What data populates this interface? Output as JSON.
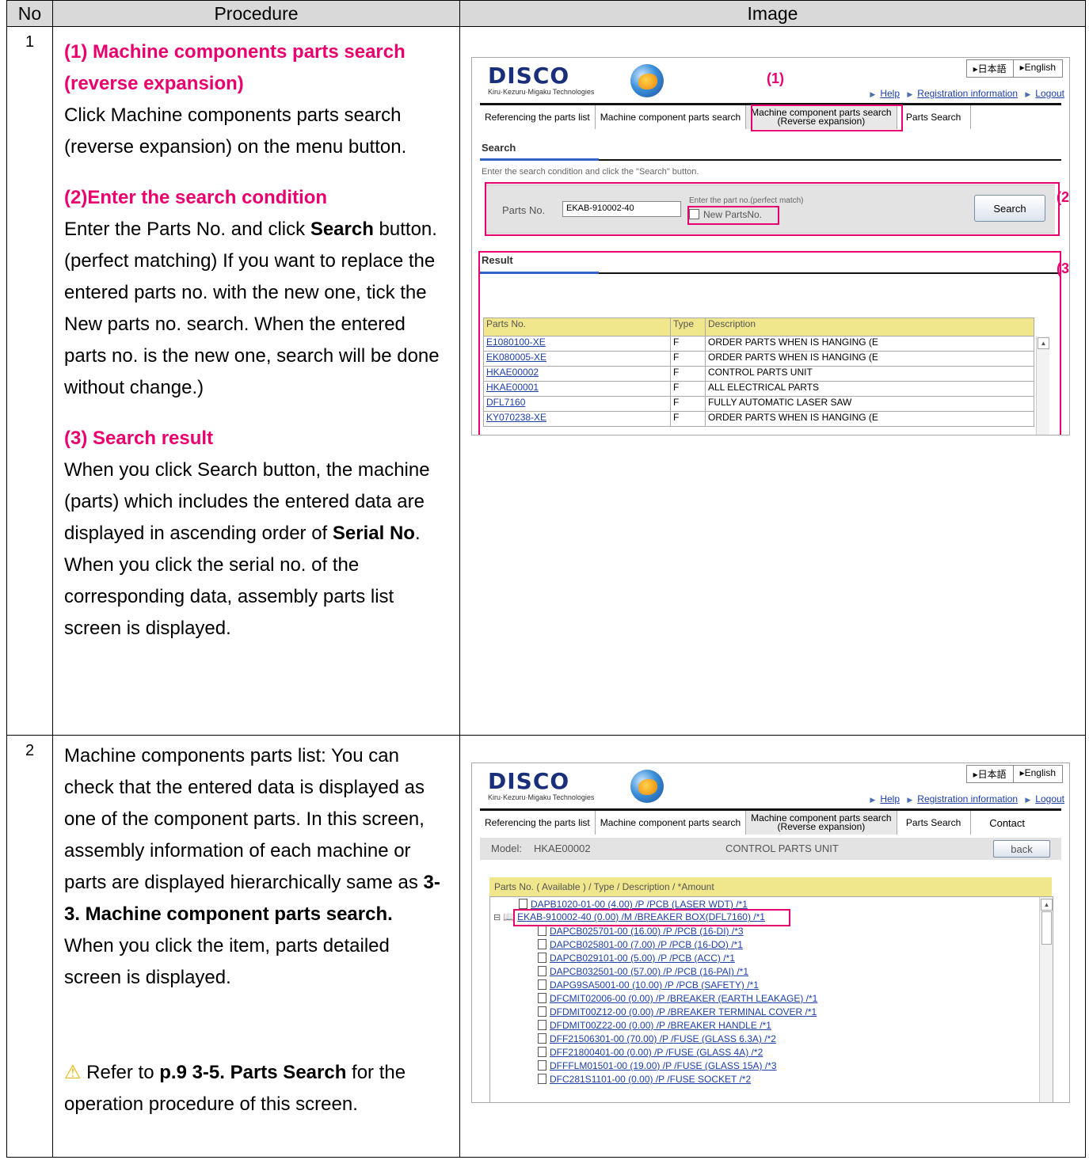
{
  "headers": {
    "no": "No",
    "procedure": "Procedure",
    "image": "Image"
  },
  "row1": {
    "no": "1",
    "s1_head": "(1) Machine components parts search (reverse expansion)",
    "s1_body": "Click Machine components parts search (reverse expansion) on the menu button.",
    "s2_head": "(2)Enter the search condition",
    "s2_a": "Enter the Parts No. and click ",
    "s2_b": "Search",
    "s2_c": " button. (perfect matching) If you want to replace the entered parts no. with the new one, tick the New parts no. search. When the entered parts no. is the new one, search will be done without change.)",
    "s3_head": "(3) Search result",
    "s3_a": "When you click Search button, the machine (parts) which includes the entered data are displayed in ascending order of ",
    "s3_b": "Serial No",
    "s3_c": ". When you click the serial no. of the corresponding data, assembly parts list screen is displayed."
  },
  "row2": {
    "no": "2",
    "p_a": "Machine components parts list: You can check that the entered data is displayed as one of the component parts. In this screen, assembly information of each machine or parts are displayed hierarchically same as ",
    "p_b": "3-3. Machine component parts search.",
    "p_c": "When you click the item, parts detailed screen is displayed.",
    "warn_icon": "⚠",
    "w_a": " Refer to ",
    "w_b": "p.9 3-5. Parts Search",
    "w_c": " for the operation procedure of this screen."
  },
  "shot": {
    "logo": "DISCO",
    "tagline": "Kiru·Kezuru·Migaku Technologies",
    "lang_ja": "▸日本語",
    "lang_en": "▸English",
    "help": "Help",
    "registration": "Registration information",
    "logout": "Logout",
    "tab1": "Referencing the parts list",
    "tab2": "Machine component parts search",
    "tab3_l1": "Machine component parts search",
    "tab3_l2": "(Reverse expansion)",
    "tab4": "Parts Search",
    "tab5": "Contact",
    "label1": "(1)",
    "label2": "(2)",
    "label3": "(3)",
    "search_title": "Search",
    "search_note": "Enter the search condition and click the \"Search\" button.",
    "parts_no_label": "Parts No.",
    "parts_no_value": "EKAB-910002-40",
    "perfect_note": "Enter the part no.(perfect match)",
    "new_parts": "New PartsNo.",
    "search_btn": "Search",
    "result_title": "Result",
    "col_parts": "Parts No.",
    "col_type": "Type",
    "col_desc": "Description",
    "rows": [
      {
        "p": "E1080100-XE",
        "t": "F",
        "d": "ORDER PARTS WHEN IS HANGING (E"
      },
      {
        "p": "EK080005-XE",
        "t": "F",
        "d": "ORDER PARTS WHEN IS HANGING (E"
      },
      {
        "p": "HKAE00002",
        "t": "F",
        "d": "CONTROL PARTS UNIT"
      },
      {
        "p": "HKAE00001",
        "t": "F",
        "d": "ALL ELECTRICAL PARTS"
      },
      {
        "p": "DFL7160",
        "t": "F",
        "d": "FULLY AUTOMATIC LASER SAW"
      },
      {
        "p": "KY070238-XE",
        "t": "F",
        "d": "ORDER PARTS WHEN IS HANGING (E"
      }
    ],
    "model_label": "Model:",
    "model_value": "HKAE00002",
    "model_desc": "CONTROL PARTS UNIT",
    "back_btn": "back",
    "tree_header": "Parts No. ( Available ) / Type / Description / *Amount",
    "tree": [
      "DAPB1020-01-00 (4.00) /P /PCB (LASER WDT) /*1",
      "EKAB-910002-40 (0.00) /M /BREAKER BOX(DFL7160) /*1",
      "DAPCB025701-00 (16.00) /P /PCB (16-DI) /*3",
      "DAPCB025801-00 (7.00) /P /PCB (16-DO) /*1",
      "DAPCB029101-00 (5.00) /P /PCB (ACC) /*1",
      "DAPCB032501-00 (57.00) /P /PCB (16-PAI) /*1",
      "DAPG9SA5001-00 (10.00) /P /PCB (SAFETY) /*1",
      "DFCMIT02006-00 (0.00) /P /BREAKER (EARTH LEAKAGE) /*1",
      "DFDMIT00Z12-00 (0.00) /P /BREAKER TERMINAL COVER /*1",
      "DFDMIT00Z22-00 (0.00) /P /BREAKER HANDLE /*1",
      "DFF21506301-00 (70.00) /P /FUSE (GLASS 6.3A) /*2",
      "DFF21800401-00 (0.00) /P /FUSE (GLASS 4A) /*2",
      "DFFFLM01501-00 (19.00) /P /FUSE (GLASS 15A) /*3",
      "DFC281S1101-00 (0.00) /P /FUSE SOCKET /*2"
    ]
  }
}
